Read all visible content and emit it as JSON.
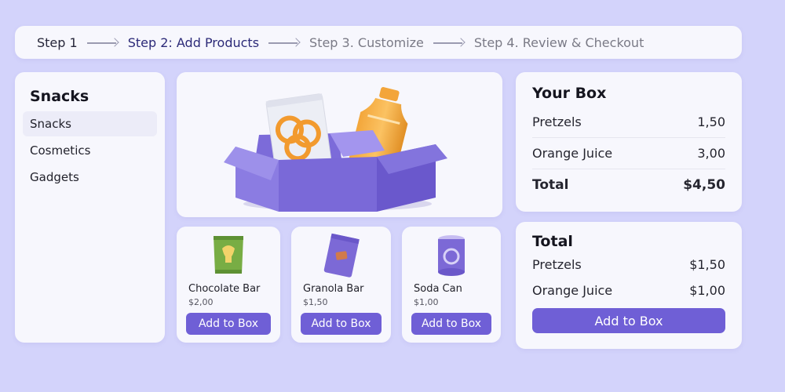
{
  "stepper": {
    "steps": [
      "Step 1",
      "Step 2: Add Products",
      "Step 3. Customize",
      "Step 4. Review & Checkout"
    ]
  },
  "sidebar": {
    "title": "Snacks",
    "items": [
      {
        "label": "Snacks",
        "selected": true
      },
      {
        "label": "Cosmetics"
      },
      {
        "label": "Gadgets"
      }
    ]
  },
  "hero": {
    "icon": "gift-box-with-snacks-illustration"
  },
  "products": [
    {
      "name": "Chocolate Bar",
      "price": "$2,00",
      "button": "Add to Box",
      "icon": "snack-bag-icon"
    },
    {
      "name": "Granola Bar",
      "price": "$1,50",
      "button": "Add to Box",
      "icon": "granola-bar-icon"
    },
    {
      "name": "Soda Can",
      "price": "$1,00",
      "button": "Add to Box",
      "icon": "soda-can-icon"
    }
  ],
  "your_box": {
    "title": "Your Box",
    "rows": [
      {
        "label": "Pretzels",
        "value": "1,50"
      },
      {
        "label": "Orange Juice",
        "value": "3,00"
      }
    ],
    "total_label": "Total",
    "total_value": "$4,50"
  },
  "total_card": {
    "title": "Total",
    "rows": [
      {
        "label": "Pretzels",
        "value": "$1,50"
      },
      {
        "label": "Orange Juice",
        "value": "$1,00"
      }
    ],
    "button": "Add to Box"
  },
  "colors": {
    "background": "#d3d3fb",
    "accent": "#6f5fd6",
    "active_step": "#2c2a78",
    "card": "#f7f7fd"
  }
}
